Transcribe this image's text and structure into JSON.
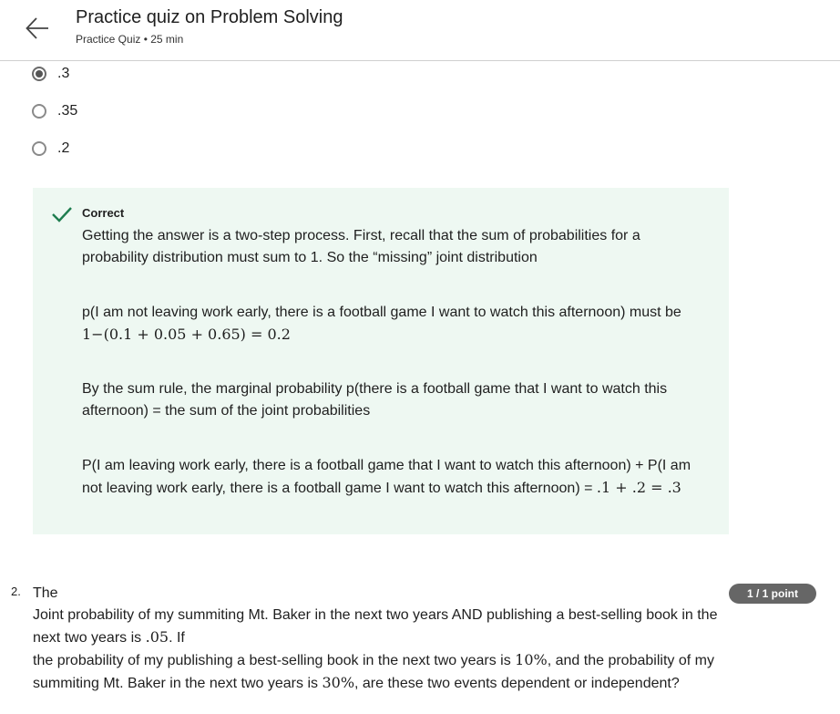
{
  "header": {
    "back_icon": "arrow-left-icon",
    "title": "Practice quiz on Problem Solving",
    "subtitle": "Practice Quiz • 25 min"
  },
  "question1": {
    "options": [
      {
        "label": ".3",
        "selected": true
      },
      {
        "label": ".35",
        "selected": false
      },
      {
        "label": ".2",
        "selected": false
      }
    ],
    "feedback": {
      "status_icon": "checkmark-icon",
      "status_color": "#1e7d4f",
      "background_color": "#eef8f2",
      "status_label": "Correct",
      "p1": "Getting the answer is a two-step process. First, recall that the sum of probabilities for a probability distribution must sum to 1. So the “missing” joint distribution",
      "p2_text": "p(I am not leaving work early, there is a football game I want to watch this afternoon) must be ",
      "p2_math": "1−(0.1 + 0.05 + 0.65) = 0.2",
      "p3": "By the sum rule, the marginal probability p(there is a football game that I want to watch this afternoon) = the sum of the joint probabilities",
      "p4_text": "P(I am leaving work early, there is a football game that I want to watch this afternoon) + P(I am not leaving work early, there is a football game I want to watch this afternoon) = ",
      "p4_math": ".1 + .2 = .3"
    }
  },
  "question2": {
    "number": "2.",
    "points": "1 / 1 point",
    "line1": "The",
    "text_a": "Joint probability of my summiting Mt. Baker in the next two years AND publishing a best-selling book in the next two years is ",
    "math_a": ".05",
    "text_b": ". If",
    "text_c": "the probability of my publishing a best-selling book in the next two years is ",
    "math_c": "10%",
    "text_d": ", and the probability of my summiting Mt. Baker in the next two years is ",
    "math_d": "30%",
    "text_e": ", are these two events dependent or independent?"
  }
}
